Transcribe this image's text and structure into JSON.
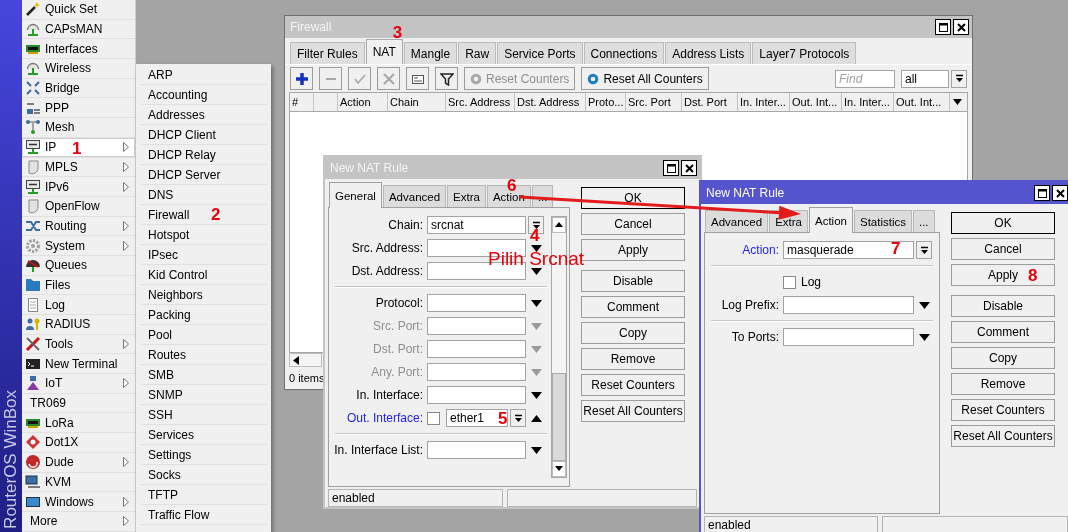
{
  "brand": "RouterOS WinBox",
  "main_menu": [
    {
      "label": "Quick Set",
      "has_submenu": false,
      "selected": false
    },
    {
      "label": "CAPsMAN",
      "has_submenu": false,
      "selected": false
    },
    {
      "label": "Interfaces",
      "has_submenu": false,
      "selected": false
    },
    {
      "label": "Wireless",
      "has_submenu": false,
      "selected": false
    },
    {
      "label": "Bridge",
      "has_submenu": false,
      "selected": false
    },
    {
      "label": "PPP",
      "has_submenu": false,
      "selected": false
    },
    {
      "label": "Mesh",
      "has_submenu": false,
      "selected": false
    },
    {
      "label": "IP",
      "has_submenu": true,
      "selected": true,
      "annotation": "1"
    },
    {
      "label": "MPLS",
      "has_submenu": true,
      "selected": false
    },
    {
      "label": "IPv6",
      "has_submenu": true,
      "selected": false
    },
    {
      "label": "OpenFlow",
      "has_submenu": false,
      "selected": false
    },
    {
      "label": "Routing",
      "has_submenu": true,
      "selected": false
    },
    {
      "label": "System",
      "has_submenu": true,
      "selected": false
    },
    {
      "label": "Queues",
      "has_submenu": false,
      "selected": false
    },
    {
      "label": "Files",
      "has_submenu": false,
      "selected": false
    },
    {
      "label": "Log",
      "has_submenu": false,
      "selected": false
    },
    {
      "label": "RADIUS",
      "has_submenu": false,
      "selected": false
    },
    {
      "label": "Tools",
      "has_submenu": true,
      "selected": false
    },
    {
      "label": "New Terminal",
      "has_submenu": false,
      "selected": false
    },
    {
      "label": "IoT",
      "has_submenu": true,
      "selected": false
    },
    {
      "label": "TR069",
      "has_submenu": false,
      "selected": false
    },
    {
      "label": "LoRa",
      "has_submenu": false,
      "selected": false
    },
    {
      "label": "Dot1X",
      "has_submenu": false,
      "selected": false
    },
    {
      "label": "Dude",
      "has_submenu": true,
      "selected": false
    },
    {
      "label": "KVM",
      "has_submenu": false,
      "selected": false
    },
    {
      "label": "Windows",
      "has_submenu": true,
      "selected": false
    },
    {
      "label": "More",
      "has_submenu": true,
      "selected": false
    }
  ],
  "submenu": [
    {
      "label": "ARP",
      "selected": false
    },
    {
      "label": "Accounting",
      "selected": false
    },
    {
      "label": "Addresses",
      "selected": false
    },
    {
      "label": "DHCP Client",
      "selected": false
    },
    {
      "label": "DHCP Relay",
      "selected": false
    },
    {
      "label": "DHCP Server",
      "selected": false
    },
    {
      "label": "DNS",
      "selected": false
    },
    {
      "label": "Firewall",
      "selected": false,
      "annotation": "2"
    },
    {
      "label": "Hotspot",
      "selected": false
    },
    {
      "label": "IPsec",
      "selected": false
    },
    {
      "label": "Kid Control",
      "selected": false
    },
    {
      "label": "Neighbors",
      "selected": false
    },
    {
      "label": "Packing",
      "selected": false
    },
    {
      "label": "Pool",
      "selected": false
    },
    {
      "label": "Routes",
      "selected": false
    },
    {
      "label": "SMB",
      "selected": false
    },
    {
      "label": "SNMP",
      "selected": false
    },
    {
      "label": "SSH",
      "selected": false
    },
    {
      "label": "Services",
      "selected": false
    },
    {
      "label": "Settings",
      "selected": false
    },
    {
      "label": "Socks",
      "selected": false
    },
    {
      "label": "TFTP",
      "selected": false
    },
    {
      "label": "Traffic Flow",
      "selected": false
    }
  ],
  "firewall": {
    "title": "Firewall",
    "active": false,
    "tabs": [
      {
        "label": "Filter Rules",
        "selected": false
      },
      {
        "label": "NAT",
        "selected": true,
        "annotation": "3"
      },
      {
        "label": "Mangle",
        "selected": false
      },
      {
        "label": "Raw",
        "selected": false
      },
      {
        "label": "Service Ports",
        "selected": false
      },
      {
        "label": "Connections",
        "selected": false
      },
      {
        "label": "Address Lists",
        "selected": false
      },
      {
        "label": "Layer7 Protocols",
        "selected": false
      }
    ],
    "toolbar": {
      "icon_buttons": [
        {
          "kind": "add",
          "disabled": false
        },
        {
          "kind": "remove",
          "disabled": true
        },
        {
          "kind": "enable",
          "disabled": true
        },
        {
          "kind": "disable",
          "disabled": true
        },
        {
          "kind": "comment",
          "disabled": false
        },
        {
          "kind": "filter",
          "disabled": false
        }
      ],
      "text_buttons": [
        {
          "label": "Reset Counters",
          "disabled": true
        },
        {
          "label": "Reset All Counters",
          "disabled": false
        }
      ],
      "find": {
        "placeholder": "Find"
      },
      "scope": {
        "value": "all"
      }
    },
    "columns": [
      "#",
      "Action",
      "Chain",
      "Src. Address",
      "Dst. Address",
      "Proto...",
      "Src. Port",
      "Dst. Port",
      "In. Inter...",
      "Out. Int...",
      "In. Inter...",
      "Out. Int..."
    ],
    "status": "0 items"
  },
  "dialogs": [
    {
      "title": "New NAT Rule",
      "active": false,
      "tabs": [
        {
          "label": "General",
          "selected": true
        },
        {
          "label": "Advanced",
          "selected": false
        },
        {
          "label": "Extra",
          "selected": false
        },
        {
          "label": "Action",
          "selected": false,
          "annotation": "6"
        },
        {
          "label": "...",
          "selected": false
        }
      ],
      "fields": [
        {
          "kind": "select",
          "label": "Chain:",
          "value": "srcnat",
          "disabled": false,
          "set": false,
          "annotation": "4",
          "note": "Pilih Srcnat"
        },
        {
          "kind": "combo",
          "label": "Src. Address:",
          "disabled": false,
          "set": false
        },
        {
          "kind": "combo",
          "label": "Dst. Address:",
          "disabled": false,
          "set": false
        },
        {
          "kind": "separator"
        },
        {
          "kind": "combo",
          "label": "Protocol:",
          "disabled": false,
          "set": false
        },
        {
          "kind": "combo",
          "label": "Src. Port:",
          "disabled": true,
          "set": false
        },
        {
          "kind": "combo",
          "label": "Dst. Port:",
          "disabled": true,
          "set": false
        },
        {
          "kind": "combo",
          "label": "Any. Port:",
          "disabled": true,
          "set": false
        },
        {
          "kind": "combo",
          "label": "In. Interface:",
          "disabled": false,
          "set": false
        },
        {
          "kind": "negatable",
          "label": "Out. Interface:",
          "value": "ether1",
          "checked": false,
          "disabled": false,
          "set": true,
          "annotation": "5"
        },
        {
          "kind": "separator"
        },
        {
          "kind": "combo",
          "label": "In. Interface List:",
          "disabled": false,
          "set": false
        }
      ],
      "button_groups": [
        [
          {
            "label": "OK",
            "default": true
          },
          {
            "label": "Cancel",
            "default": false
          },
          {
            "label": "Apply",
            "default": false
          }
        ],
        [
          {
            "label": "Disable",
            "default": false
          },
          {
            "label": "Comment",
            "default": false
          },
          {
            "label": "Copy",
            "default": false
          },
          {
            "label": "Remove",
            "default": false
          },
          {
            "label": "Reset Counters",
            "default": false
          },
          {
            "label": "Reset All Counters",
            "default": false
          }
        ]
      ],
      "status": "enabled"
    },
    {
      "title": "New NAT Rule",
      "active": true,
      "tabs": [
        {
          "label": "Advanced",
          "selected": false
        },
        {
          "label": "Extra",
          "selected": false
        },
        {
          "label": "Action",
          "selected": true
        },
        {
          "label": "Statistics",
          "selected": false
        },
        {
          "label": "...",
          "selected": false
        }
      ],
      "fields": [
        {
          "kind": "select",
          "label": "Action:",
          "value": "masquerade",
          "disabled": false,
          "set": true,
          "annotation": "7"
        },
        {
          "kind": "separator"
        },
        {
          "kind": "checkbox",
          "label": "Log",
          "checked": false
        },
        {
          "kind": "combo",
          "label": "Log Prefix:",
          "disabled": false,
          "set": false
        },
        {
          "kind": "separator"
        },
        {
          "kind": "combo",
          "label": "To Ports:",
          "disabled": false,
          "set": false
        }
      ],
      "button_groups": [
        [
          {
            "label": "OK",
            "default": true
          },
          {
            "label": "Cancel",
            "default": false
          },
          {
            "label": "Apply",
            "default": false,
            "annotation": "8"
          }
        ],
        [
          {
            "label": "Disable",
            "default": false
          },
          {
            "label": "Comment",
            "default": false
          },
          {
            "label": "Copy",
            "default": false
          },
          {
            "label": "Remove",
            "default": false
          },
          {
            "label": "Reset Counters",
            "default": false
          },
          {
            "label": "Reset All Counters",
            "default": false
          }
        ]
      ],
      "status": "enabled"
    }
  ]
}
